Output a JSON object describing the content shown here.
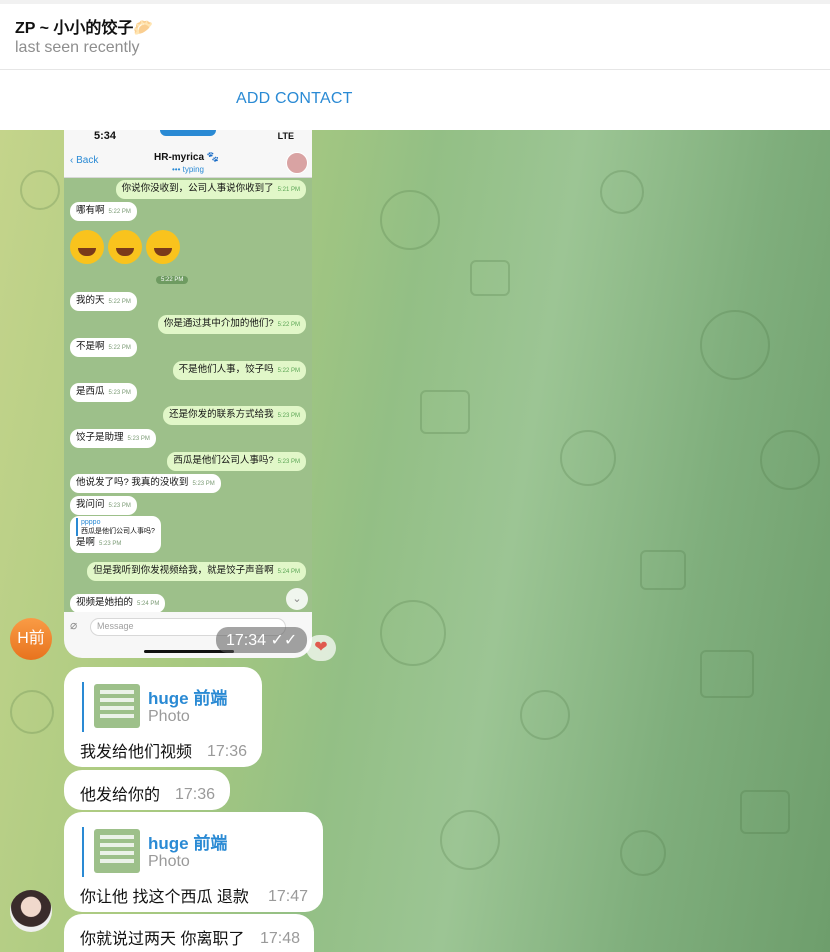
{
  "header": {
    "name": "ZP ~ 小小的饺子",
    "name_emoji": "🥟",
    "status": "last seen recently"
  },
  "add_contact": {
    "label": "ADD CONTACT"
  },
  "screenshot": {
    "phone_time": "5:34",
    "signal": "LTE",
    "back_label": "Back",
    "chat_title": "HR-myrica 🐾",
    "typing": "••• typing",
    "input_placeholder": "Message",
    "emoji_time": "5:22 PM",
    "messages": [
      {
        "text": "你说你没收到，公司人事说你收到了",
        "time": "5:21 PM",
        "out": true
      },
      {
        "text": "哪有啊",
        "time": "5:22 PM",
        "out": false
      },
      {
        "text": "我的天",
        "time": "5:22 PM",
        "out": false
      },
      {
        "text": "你是通过其中介加的他们?",
        "time": "5:22 PM",
        "out": true
      },
      {
        "text": "不是啊",
        "time": "5:22 PM",
        "out": false
      },
      {
        "text": "不是他们人事，饺子吗",
        "time": "5:22 PM",
        "out": true
      },
      {
        "text": "是西瓜",
        "time": "5:23 PM",
        "out": false
      },
      {
        "text": "还是你发的联系方式给我",
        "time": "5:23 PM",
        "out": true
      },
      {
        "text": "饺子是助理",
        "time": "5:23 PM",
        "out": false
      },
      {
        "text": "西瓜是他们公司人事吗?",
        "time": "5:23 PM",
        "out": true
      },
      {
        "text": "他说发了吗? 我真的没收到",
        "time": "5:23 PM",
        "out": false
      },
      {
        "text": "我问问",
        "time": "5:23 PM",
        "out": false
      },
      {
        "text": "是啊",
        "time": "5:23 PM",
        "out": false,
        "reply_name": "ppppo",
        "reply_text": "西瓜是他们公司人事吗?"
      },
      {
        "text": "但是我听到你发视频给我，就是饺子声音啊",
        "time": "5:24 PM",
        "out": true
      },
      {
        "text": "视频是她拍的",
        "time": "5:24 PM",
        "out": false
      }
    ],
    "sent_time": "17:34",
    "reaction": "❤"
  },
  "avatars": {
    "h_initials": "H前"
  },
  "messages": [
    {
      "reply_name": "huge 前端",
      "reply_type": "Photo",
      "text": "我发给他们视频",
      "time": "17:36"
    },
    {
      "text": "他发给你的",
      "time": "17:36"
    },
    {
      "reply_name": "huge 前端",
      "reply_type": "Photo",
      "text": "你让他 找这个西瓜  退款",
      "time": "17:47"
    },
    {
      "text": "你就说过两天 你离职了",
      "time": "17:48"
    }
  ],
  "colors": {
    "accent": "#2a8ad4",
    "header_bg": "#ffffff",
    "bubble_bg": "#ffffff"
  }
}
